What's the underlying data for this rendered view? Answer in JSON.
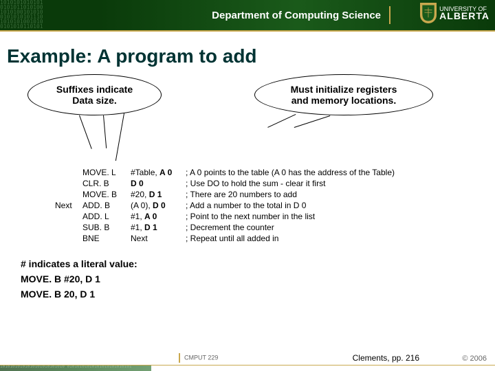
{
  "header": {
    "department": "Department of Computing Science",
    "university_small": "UNIVERSITY OF",
    "university_big": "ALBERTA"
  },
  "title": "Example: A program to add",
  "bubble_left": {
    "line1": "Suffixes indicate",
    "line2": "Data size."
  },
  "bubble_right": {
    "line1": "Must initialize registers",
    "line2": "and memory locations."
  },
  "code": [
    {
      "label": "",
      "op": "MOVE. L",
      "arg_pre": "#Table, ",
      "arg_b": "A 0",
      "comment": " ; A 0 points to the table (A 0 has the address of the Table)"
    },
    {
      "label": "",
      "op": "CLR. B",
      "arg_pre": "",
      "arg_b": "D 0",
      "comment": "; Use DO to hold the sum - clear it first"
    },
    {
      "label": "",
      "op": "MOVE. B",
      "arg_pre": "#20, ",
      "arg_b": "D 1",
      "comment": "; There are 20 numbers to add"
    },
    {
      "label": "Next",
      "op": "ADD. B",
      "arg_pre": "(A 0), ",
      "arg_b": "D 0",
      "comment": "; Add a number to the total in D 0"
    },
    {
      "label": "",
      "op": "ADD. L",
      "arg_pre": "#1, ",
      "arg_b": "A 0",
      "comment": "; Point to the next number in the list"
    },
    {
      "label": "",
      "op": "SUB. B",
      "arg_pre": "#1, ",
      "arg_b": "D 1",
      "comment": "; Decrement the counter"
    },
    {
      "label": "",
      "op": "BNE",
      "arg_pre": "Next",
      "arg_b": "",
      "comment": "; Repeat until all added in"
    }
  ],
  "literal": {
    "l1": "# indicates a literal value:",
    "l2": "MOVE. B  #20, D 1",
    "l3": "MOVE. B   20, D 1"
  },
  "footer": {
    "course": "CMPUT 229",
    "citation": "Clements, pp. 216",
    "copyright": "© 2006"
  }
}
